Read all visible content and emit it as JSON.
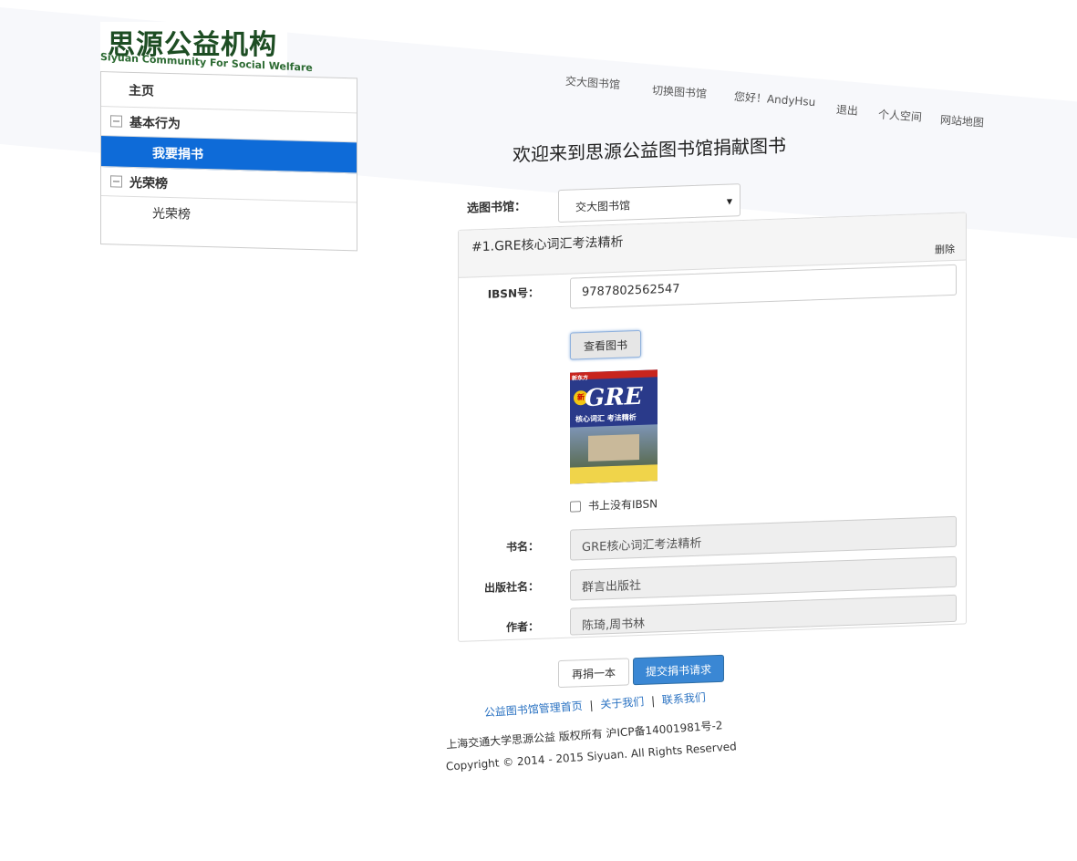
{
  "logo": {
    "title_cn": "思源公益机构",
    "title_en": "Siyuan Community For Social Welfare"
  },
  "topnav": {
    "items": [
      "交大图书馆",
      "切换图书馆",
      "您好！AndyHsu",
      "退出",
      "个人空间",
      "网站地图"
    ]
  },
  "sidebar": {
    "home": "主页",
    "group1": "基本行为",
    "group1_item": "我要捐书",
    "group2": "光荣榜",
    "group2_item": "光荣榜"
  },
  "main": {
    "title": "欢迎来到思源公益图书馆捐献图书",
    "library_label": "选图书馆：",
    "library_selected": "交大图书馆"
  },
  "panel": {
    "title": "#1.GRE核心词汇考法精析",
    "delete": "删除",
    "isbn_label": "IBSN号：",
    "isbn_value": "9787802562547",
    "view_button": "查看图书",
    "cover": {
      "brand": "新东方",
      "badge": "新",
      "gre": "GRE",
      "subtitle": "核心词汇 考法精析"
    },
    "no_isbn_label": "书上没有IBSN",
    "book_name_label": "书名：",
    "book_name_value": "GRE核心词汇考法精析",
    "publisher_label": "出版社名：",
    "publisher_value": "群言出版社",
    "author_label": "作者：",
    "author_value": "陈琦,周书林"
  },
  "actions": {
    "again": "再捐一本",
    "submit": "提交捐书请求"
  },
  "footer": {
    "link1": "公益图书馆管理首页",
    "link2": "关于我们",
    "link3": "联系我们",
    "sep": "|",
    "copyright_cn": "上海交通大学思源公益 版权所有 沪ICP备14001981号-2",
    "copyright_en": "Copyright © 2014 - 2015 Siyuan. All Rights Reserved"
  }
}
